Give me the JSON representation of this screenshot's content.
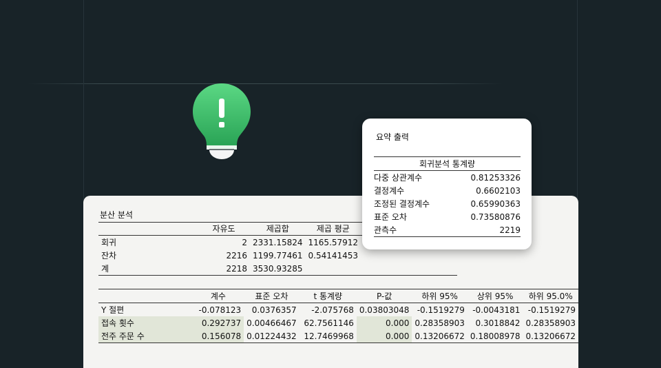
{
  "anova": {
    "title": "분산 분석",
    "headers": [
      "",
      "자유도",
      "제곱합",
      "제곱 평균"
    ],
    "rows": [
      {
        "label": "회귀",
        "df": "2",
        "ss": "2331.15824",
        "ms": "1165.57912"
      },
      {
        "label": "잔차",
        "df": "2216",
        "ss": "1199.77461",
        "ms": "0.54141453"
      },
      {
        "label": "계",
        "df": "2218",
        "ss": "3530.93285",
        "ms": ""
      }
    ]
  },
  "coefficients": {
    "headers": [
      "",
      "계수",
      "표준 오차",
      "t 통계량",
      "P-값",
      "하위 95%",
      "상위 95%",
      "하위 95.0%"
    ],
    "rows": [
      {
        "label": "Y 절편",
        "coef": "-0.078123",
        "se": "0.0376357",
        "t": "-2.075768",
        "p": "0.03803048",
        "lo95": "-0.1519279",
        "hi95": "-0.0043181",
        "lo950": "-0.1519279"
      },
      {
        "label": "접속 횟수",
        "coef": "0.292737",
        "se": "0.00466467",
        "t": "62.7561146",
        "p": "0.000",
        "lo95": "0.28358903",
        "hi95": "0.3018842",
        "lo950": "0.28358903"
      },
      {
        "label": "전주 주문 수",
        "coef": "0.156078",
        "se": "0.01224432",
        "t": "12.7469968",
        "p": "0.000",
        "lo95": "0.13206672",
        "hi95": "0.18008978",
        "lo950": "0.13206672"
      }
    ]
  },
  "summary": {
    "title": "요약 출력",
    "table_header": "회귀분석 통계량",
    "rows": [
      {
        "label": "다중 상관계수",
        "value": "0.81253326"
      },
      {
        "label": "결정계수",
        "value": "0.6602103"
      },
      {
        "label": "조정된 결정계수",
        "value": "0.65990363"
      },
      {
        "label": "표준 오차",
        "value": "0.73580876"
      },
      {
        "label": "관측수",
        "value": "2219"
      }
    ]
  },
  "colors": {
    "background": "#182328",
    "bulb_green": "#3cc86a",
    "highlight": "#e1e6d8"
  },
  "icons": {
    "bulb": "lightbulb-exclamation-icon"
  }
}
